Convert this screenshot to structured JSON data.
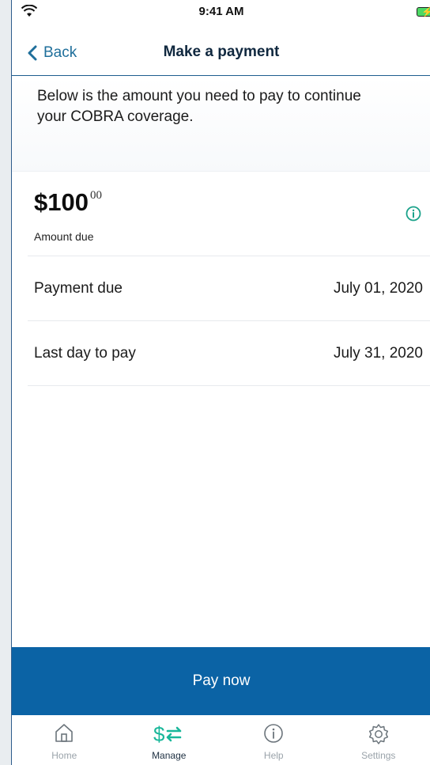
{
  "status_bar": {
    "time": "9:41 AM"
  },
  "nav": {
    "back_label": "Back",
    "title": "Make a payment"
  },
  "intro": {
    "text": "Below is the amount you need to pay to continue your COBRA coverage."
  },
  "amount": {
    "main": "$100",
    "cents": "00",
    "label": "Amount due"
  },
  "details": [
    {
      "label": "Payment due",
      "value": "July 01, 2020"
    },
    {
      "label": "Last day to pay",
      "value": "July 31, 2020"
    }
  ],
  "actions": {
    "pay_now": "Pay now"
  },
  "tabs": [
    {
      "label": "Home",
      "icon": "home-icon"
    },
    {
      "label": "Manage",
      "icon": "manage-dollar-icon",
      "active": true
    },
    {
      "label": "Help",
      "icon": "info-circle-icon"
    },
    {
      "label": "Settings",
      "icon": "gear-icon"
    }
  ],
  "colors": {
    "accent": "#0b63a5",
    "link": "#1f6f9b",
    "active_tab_icon": "#19b79a",
    "info_icon": "#1aa28a"
  }
}
